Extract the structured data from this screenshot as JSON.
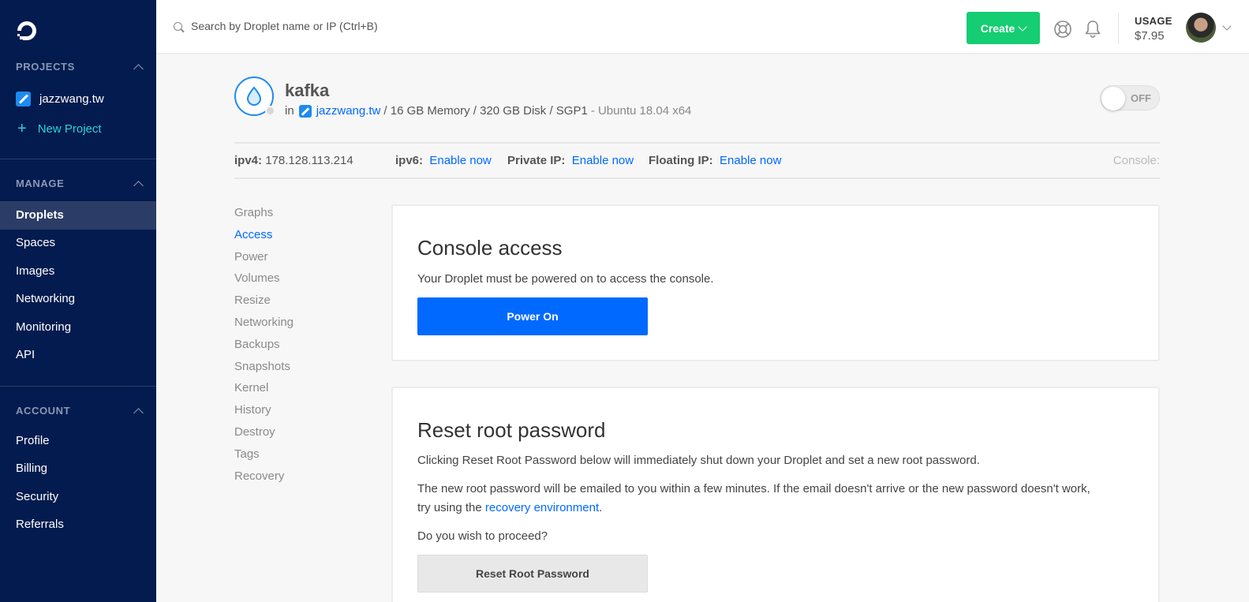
{
  "sidebar": {
    "projects_heading": "PROJECTS",
    "project_name": "jazzwang.tw",
    "new_project": "New Project",
    "manage_heading": "MANAGE",
    "manage_items": [
      "Droplets",
      "Spaces",
      "Images",
      "Networking",
      "Monitoring",
      "API"
    ],
    "active_item": "Droplets",
    "account_heading": "ACCOUNT",
    "account_items": [
      "Profile",
      "Billing",
      "Security",
      "Referrals"
    ]
  },
  "topbar": {
    "search_placeholder": "Search by Droplet name or IP (Ctrl+B)",
    "create_label": "Create",
    "usage_label": "USAGE",
    "usage_value": "$7.95",
    "icons": [
      "help-icon",
      "bell-icon"
    ]
  },
  "droplet": {
    "name": "kafka",
    "in_label": "in",
    "project": "jazzwang.tw",
    "specs": "/ 16 GB Memory / 320 GB Disk / SGP1",
    "os": "- Ubuntu 18.04 x64",
    "power_state": "OFF"
  },
  "ip_bar": {
    "ipv4_label": "ipv4:",
    "ipv4_value": "178.128.113.214",
    "ipv6_label": "ipv6:",
    "ipv6_action": "Enable now",
    "private_label": "Private IP:",
    "private_action": "Enable now",
    "floating_label": "Floating IP:",
    "floating_action": "Enable now",
    "console_label": "Console:"
  },
  "subnav": {
    "items": [
      "Graphs",
      "Access",
      "Power",
      "Volumes",
      "Resize",
      "Networking",
      "Backups",
      "Snapshots",
      "Kernel",
      "History",
      "Destroy",
      "Tags",
      "Recovery"
    ],
    "active": "Access"
  },
  "console_panel": {
    "title": "Console access",
    "text": "Your Droplet must be powered on to access the console.",
    "button": "Power On"
  },
  "reset_panel": {
    "title": "Reset root password",
    "text1": "Clicking Reset Root Password below will immediately shut down your Droplet and set a new root password.",
    "text2_line1": "The new root password will be emailed to you within a few minutes. If the email doesn't arrive or the new password doesn't work,",
    "text2_prefix": "try using the ",
    "text2_link": "recovery environment",
    "text2_suffix": ".",
    "question": "Do you wish to proceed?",
    "button": "Reset Root Password"
  },
  "colors": {
    "sidebar_bg": "#031b4e",
    "accent_blue": "#0069ff",
    "create_green": "#15cd72",
    "new_project_cyan": "#2ed1dd"
  }
}
